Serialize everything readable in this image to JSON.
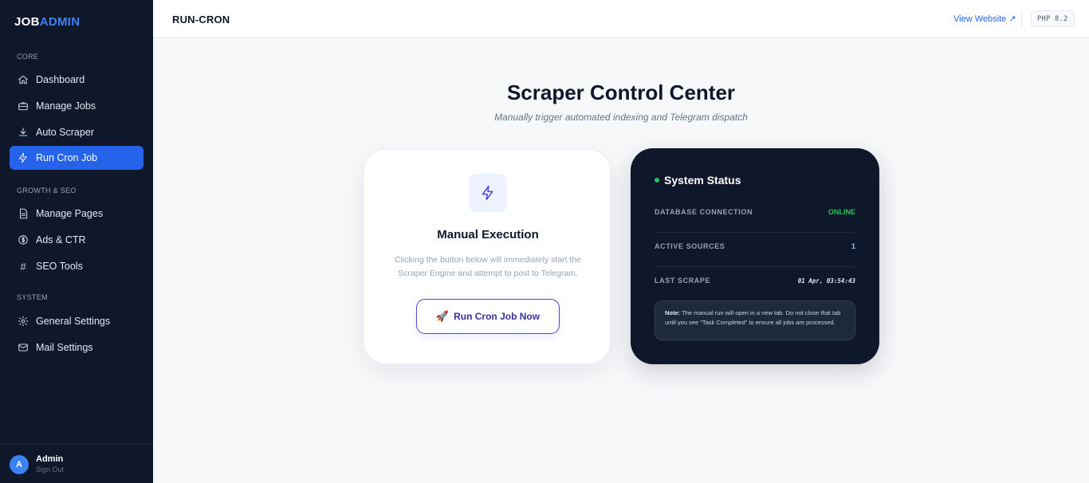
{
  "brand": {
    "part1": "JOB",
    "part2": "ADMIN"
  },
  "sidebar": {
    "sections": [
      {
        "label": "CORE"
      },
      {
        "label": "GROWTH & SEO"
      },
      {
        "label": "SYSTEM"
      }
    ],
    "items": [
      {
        "label": "Dashboard",
        "icon": "home-icon"
      },
      {
        "label": "Manage Jobs",
        "icon": "briefcase-icon"
      },
      {
        "label": "Auto Scraper",
        "icon": "download-icon"
      },
      {
        "label": "Run Cron Job",
        "icon": "bolt-icon",
        "active": true
      },
      {
        "label": "Manage Pages",
        "icon": "file-icon"
      },
      {
        "label": "Ads & CTR",
        "icon": "dollar-circle-icon"
      },
      {
        "label": "SEO Tools",
        "icon": "hash-icon"
      },
      {
        "label": "General Settings",
        "icon": "gear-icon"
      },
      {
        "label": "Mail Settings",
        "icon": "mail-icon"
      }
    ],
    "user": {
      "initial": "A",
      "name": "Admin",
      "signout": "Sign Out"
    }
  },
  "header": {
    "title": "RUN-CRON",
    "view_website": "View Website ↗",
    "php_badge": "PHP 8.2"
  },
  "main": {
    "title": "Scraper Control Center",
    "subtitle": "Manually trigger automated indexing and Telegram dispatch"
  },
  "manual_card": {
    "title": "Manual Execution",
    "description": "Clicking the button below will immediately start the Scraper Engine and attempt to post to Telegram.",
    "button_icon": "🚀",
    "button_label": "Run Cron Job Now"
  },
  "status_card": {
    "title": "System Status",
    "rows": [
      {
        "label": "DATABASE CONNECTION",
        "value": "ONLINE"
      },
      {
        "label": "ACTIVE SOURCES",
        "value": "1"
      },
      {
        "label": "LAST SCRAPE",
        "value": "01 Apr, 03:54:43"
      }
    ],
    "note_bold": "Note:",
    "note_text": " The manual run will open in a new tab. Do not close that tab until you see \"Task Completed\" to ensure all jobs are processed."
  },
  "colors": {
    "sidebar_bg": "#0f172a",
    "accent": "#2563eb",
    "online": "#22c55e",
    "indigo": "#4f46e5"
  }
}
